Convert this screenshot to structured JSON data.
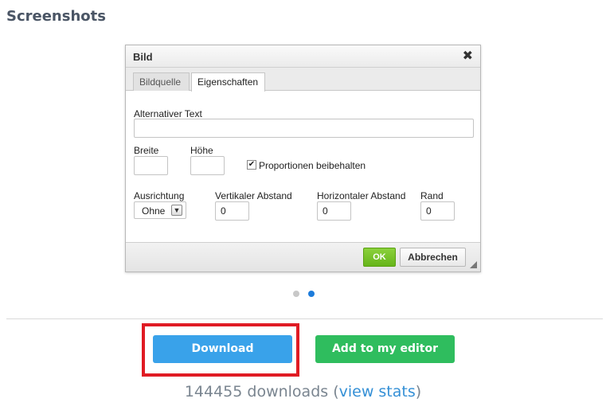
{
  "section": {
    "title": "Screenshots"
  },
  "dialog": {
    "title": "Bild",
    "close_glyph": "✖",
    "tabs": [
      {
        "label": "Bildquelle",
        "active": false
      },
      {
        "label": "Eigenschaften",
        "active": true
      }
    ],
    "fields": {
      "alt_text": {
        "label": "Alternativer Text",
        "value": ""
      },
      "width": {
        "label": "Breite",
        "value": ""
      },
      "height": {
        "label": "Höhe",
        "value": ""
      },
      "keep_proportions": {
        "label": "Proportionen beibehalten",
        "checked": true,
        "glyph": "✔"
      },
      "alignment": {
        "label": "Ausrichtung",
        "selected": "Ohne"
      },
      "vertical_spacing": {
        "label": "Vertikaler Abstand",
        "value": "0"
      },
      "horizontal_spacing": {
        "label": "Horizontaler Abstand",
        "value": "0"
      },
      "border": {
        "label": "Rand",
        "value": "0"
      }
    },
    "buttons": {
      "ok": "OK",
      "cancel": "Abbrechen"
    }
  },
  "carousel": {
    "count": 2,
    "active_index": 1
  },
  "actions": {
    "download_label": "Download",
    "add_label": "Add to my editor",
    "highlight_color": "#e01b24"
  },
  "stats": {
    "downloads_text": "144455 downloads",
    "open_paren": " (",
    "link_label": "view stats",
    "close_paren": ")"
  },
  "colors": {
    "download_blue": "#39a2ea",
    "add_green": "#2fbd5e",
    "ok_green": "#66b51a",
    "active_dot": "#1d7cdb"
  }
}
